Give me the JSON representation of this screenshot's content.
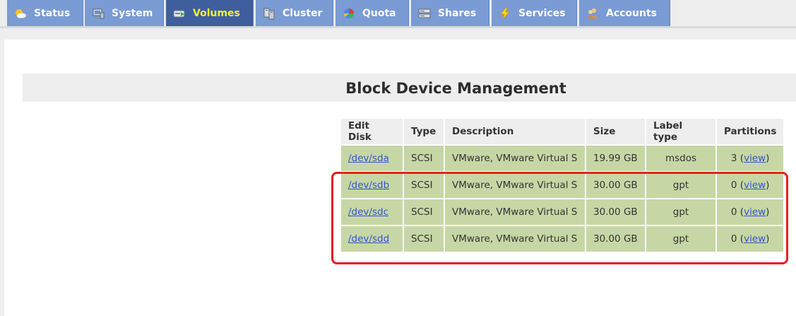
{
  "tabs": [
    {
      "label": "Status",
      "icon": "status-icon",
      "active": false
    },
    {
      "label": "System",
      "icon": "system-icon",
      "active": false
    },
    {
      "label": "Volumes",
      "icon": "volumes-icon",
      "active": true
    },
    {
      "label": "Cluster",
      "icon": "cluster-icon",
      "active": false
    },
    {
      "label": "Quota",
      "icon": "quota-icon",
      "active": false
    },
    {
      "label": "Shares",
      "icon": "shares-icon",
      "active": false
    },
    {
      "label": "Services",
      "icon": "services-icon",
      "active": false
    },
    {
      "label": "Accounts",
      "icon": "accounts-icon",
      "active": false
    }
  ],
  "page": {
    "title": "Block Device Management"
  },
  "table": {
    "headers": [
      "Edit Disk",
      "Type",
      "Description",
      "Size",
      "Label type",
      "Partitions"
    ],
    "rows": [
      {
        "disk": "/dev/sda",
        "type": "SCSI",
        "description": "VMware, VMware Virtual S",
        "size": "19.99 GB",
        "label_type": "msdos",
        "partitions_count": "3",
        "view": "view"
      },
      {
        "disk": "/dev/sdb",
        "type": "SCSI",
        "description": "VMware, VMware Virtual S",
        "size": "30.00 GB",
        "label_type": "gpt",
        "partitions_count": "0",
        "view": "view"
      },
      {
        "disk": "/dev/sdc",
        "type": "SCSI",
        "description": "VMware, VMware Virtual S",
        "size": "30.00 GB",
        "label_type": "gpt",
        "partitions_count": "0",
        "view": "view"
      },
      {
        "disk": "/dev/sdd",
        "type": "SCSI",
        "description": "VMware, VMware Virtual S",
        "size": "30.00 GB",
        "label_type": "gpt",
        "partitions_count": "0",
        "view": "view"
      }
    ]
  },
  "colors": {
    "tab_bg": "#7a9bd4",
    "tab_active_bg": "#3f5e9d",
    "tab_active_text": "#f2f236",
    "row_bg": "#c6d7a5",
    "highlight": "#e52020",
    "link": "#3355cc"
  }
}
